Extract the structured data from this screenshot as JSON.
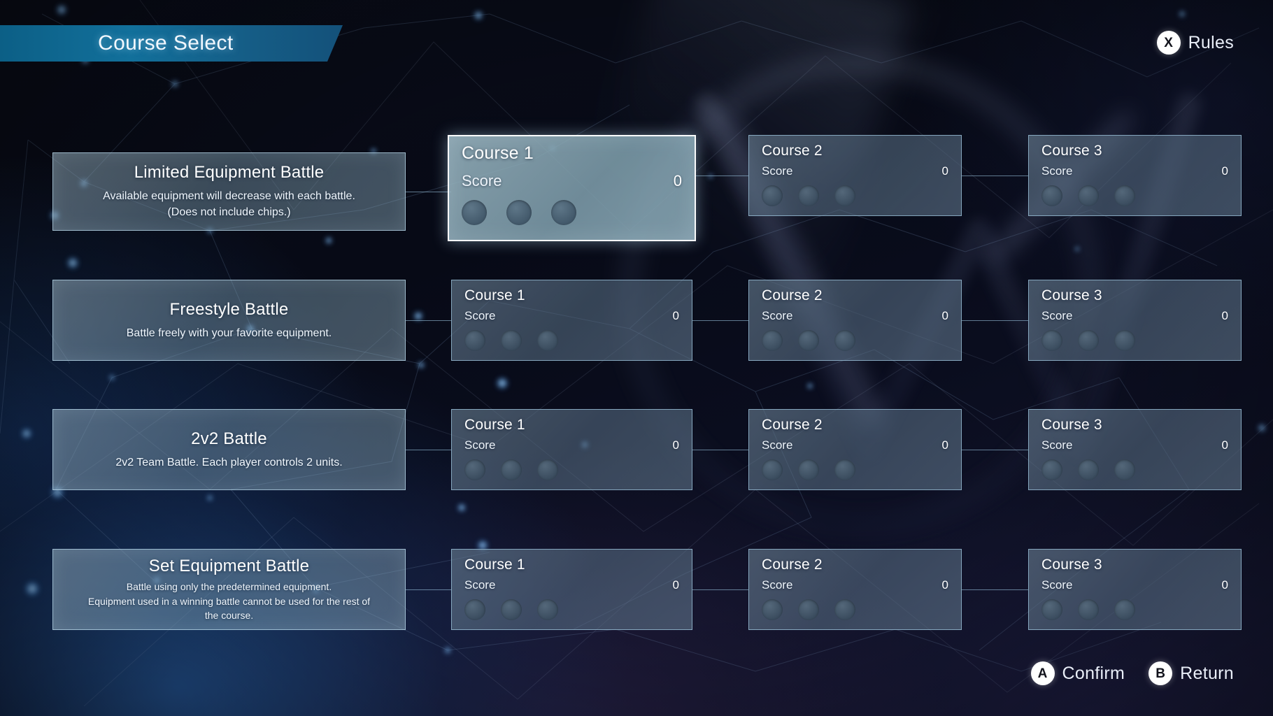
{
  "header": {
    "title": "Course Select",
    "rules_prompt": {
      "button_glyph": "X",
      "button_name": "x-button",
      "label": "Rules"
    }
  },
  "footer": {
    "prompts": [
      {
        "button_glyph": "A",
        "button_name": "a-button",
        "label": "Confirm"
      },
      {
        "button_glyph": "B",
        "button_name": "b-button",
        "label": "Return"
      }
    ]
  },
  "colors": {
    "banner_accent": "#12709b",
    "card_border": "#98bed6",
    "selected_border": "#ffffff",
    "text_primary": "#ffffff",
    "background_deep": "#070a16"
  },
  "rows": [
    {
      "mode": {
        "title": "Limited Equipment Battle",
        "description": "Available equipment will decrease with each battle.\n(Does not include chips.)",
        "desc_line1": "Available equipment will decrease with each battle.",
        "desc_line2": "(Does not include chips.)",
        "desc_line3": ""
      },
      "courses": [
        {
          "name": "Course 1",
          "score_label": "Score",
          "score": "0",
          "dots": 3,
          "selected": true
        },
        {
          "name": "Course 2",
          "score_label": "Score",
          "score": "0",
          "dots": 3,
          "selected": false
        },
        {
          "name": "Course 3",
          "score_label": "Score",
          "score": "0",
          "dots": 3,
          "selected": false
        }
      ]
    },
    {
      "mode": {
        "title": "Freestyle Battle",
        "description": "Battle freely with your favorite equipment.",
        "desc_line1": "Battle freely with your favorite equipment.",
        "desc_line2": "",
        "desc_line3": ""
      },
      "courses": [
        {
          "name": "Course 1",
          "score_label": "Score",
          "score": "0",
          "dots": 3,
          "selected": false
        },
        {
          "name": "Course 2",
          "score_label": "Score",
          "score": "0",
          "dots": 3,
          "selected": false
        },
        {
          "name": "Course 3",
          "score_label": "Score",
          "score": "0",
          "dots": 3,
          "selected": false
        }
      ]
    },
    {
      "mode": {
        "title": "2v2 Battle",
        "description": "2v2 Team Battle. Each player controls 2 units.",
        "desc_line1": "2v2 Team Battle. Each player controls 2 units.",
        "desc_line2": "",
        "desc_line3": ""
      },
      "courses": [
        {
          "name": "Course 1",
          "score_label": "Score",
          "score": "0",
          "dots": 3,
          "selected": false
        },
        {
          "name": "Course 2",
          "score_label": "Score",
          "score": "0",
          "dots": 3,
          "selected": false
        },
        {
          "name": "Course 3",
          "score_label": "Score",
          "score": "0",
          "dots": 3,
          "selected": false
        }
      ]
    },
    {
      "mode": {
        "title": "Set Equipment Battle",
        "description": "Battle using only the predetermined equipment.\nEquipment used in a winning battle cannot be used for the rest of\nthe course.",
        "desc_line1": "Battle using only the predetermined equipment.",
        "desc_line2": "Equipment used in a winning battle cannot be used for the rest of",
        "desc_line3": "the course."
      },
      "courses": [
        {
          "name": "Course 1",
          "score_label": "Score",
          "score": "0",
          "dots": 3,
          "selected": false
        },
        {
          "name": "Course 2",
          "score_label": "Score",
          "score": "0",
          "dots": 3,
          "selected": false
        },
        {
          "name": "Course 3",
          "score_label": "Score",
          "score": "0",
          "dots": 3,
          "selected": false
        }
      ]
    }
  ]
}
